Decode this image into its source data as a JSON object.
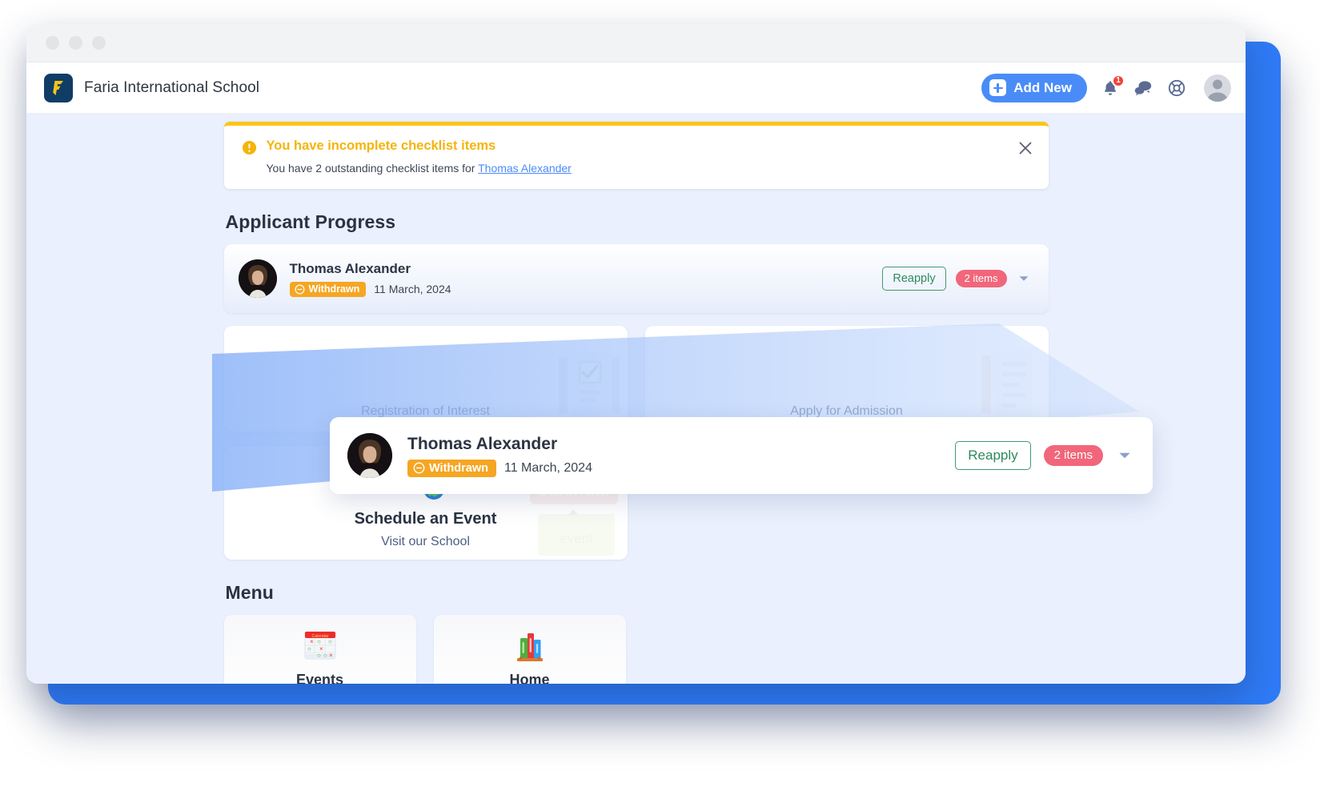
{
  "window": {
    "traffic_lights": [
      "close",
      "minimize",
      "maximize"
    ]
  },
  "header": {
    "brand_name": "Faria International School",
    "brand_logo_icon": "faria-f-logo",
    "add_new_label": "Add New",
    "notification_count": "1",
    "icons": [
      "bell-icon",
      "chat-icon",
      "lifebuoy-help-icon",
      "user-avatar-icon"
    ]
  },
  "alert": {
    "icon": "exclamation-circle-icon",
    "title": "You have incomplete checklist items",
    "body_prefix": "You have 2 outstanding checklist items for ",
    "link_text": "Thomas Alexander",
    "close_icon": "close-icon",
    "accent_color": "#fbc51b"
  },
  "applicant_progress": {
    "section_title": "Applicant Progress",
    "applicant": {
      "name": "Thomas Alexander",
      "status": "Withdrawn",
      "status_icon": "minus-circle-icon",
      "status_color": "#f5a623",
      "date": "11 March, 2024",
      "reapply_label": "Reapply",
      "items_badge": "2 items",
      "items_badge_color": "#f1667a",
      "chevron_icon": "chevron-down-icon"
    },
    "tiles": [
      {
        "label": "Registration of Interest",
        "art_icon": "checklist-clipboard-art"
      },
      {
        "label": "Apply for Admission",
        "art_icon": "document-lines-art"
      }
    ],
    "event_tile": {
      "icon": "calendar-globe-pin-icon",
      "title": "Schedule an Event",
      "subtitle": "Visit our School",
      "art_icon": "calendar-event-note-art",
      "art_text_1": "Calendar",
      "art_text_2": "event"
    }
  },
  "menu": {
    "section_title": "Menu",
    "items": [
      {
        "label": "Events",
        "icon": "calendar-xo-icon"
      },
      {
        "label": "Home",
        "icon": "books-shelf-icon"
      }
    ]
  },
  "magnified_callout": {
    "name": "Thomas Alexander",
    "status": "Withdrawn",
    "date": "11 March, 2024",
    "reapply_label": "Reapply",
    "items_badge": "2 items"
  },
  "theme": {
    "page_background": "#eaf0fd",
    "outer_frame": "#2f7bf6",
    "primary_button": "#4a8cf7"
  }
}
